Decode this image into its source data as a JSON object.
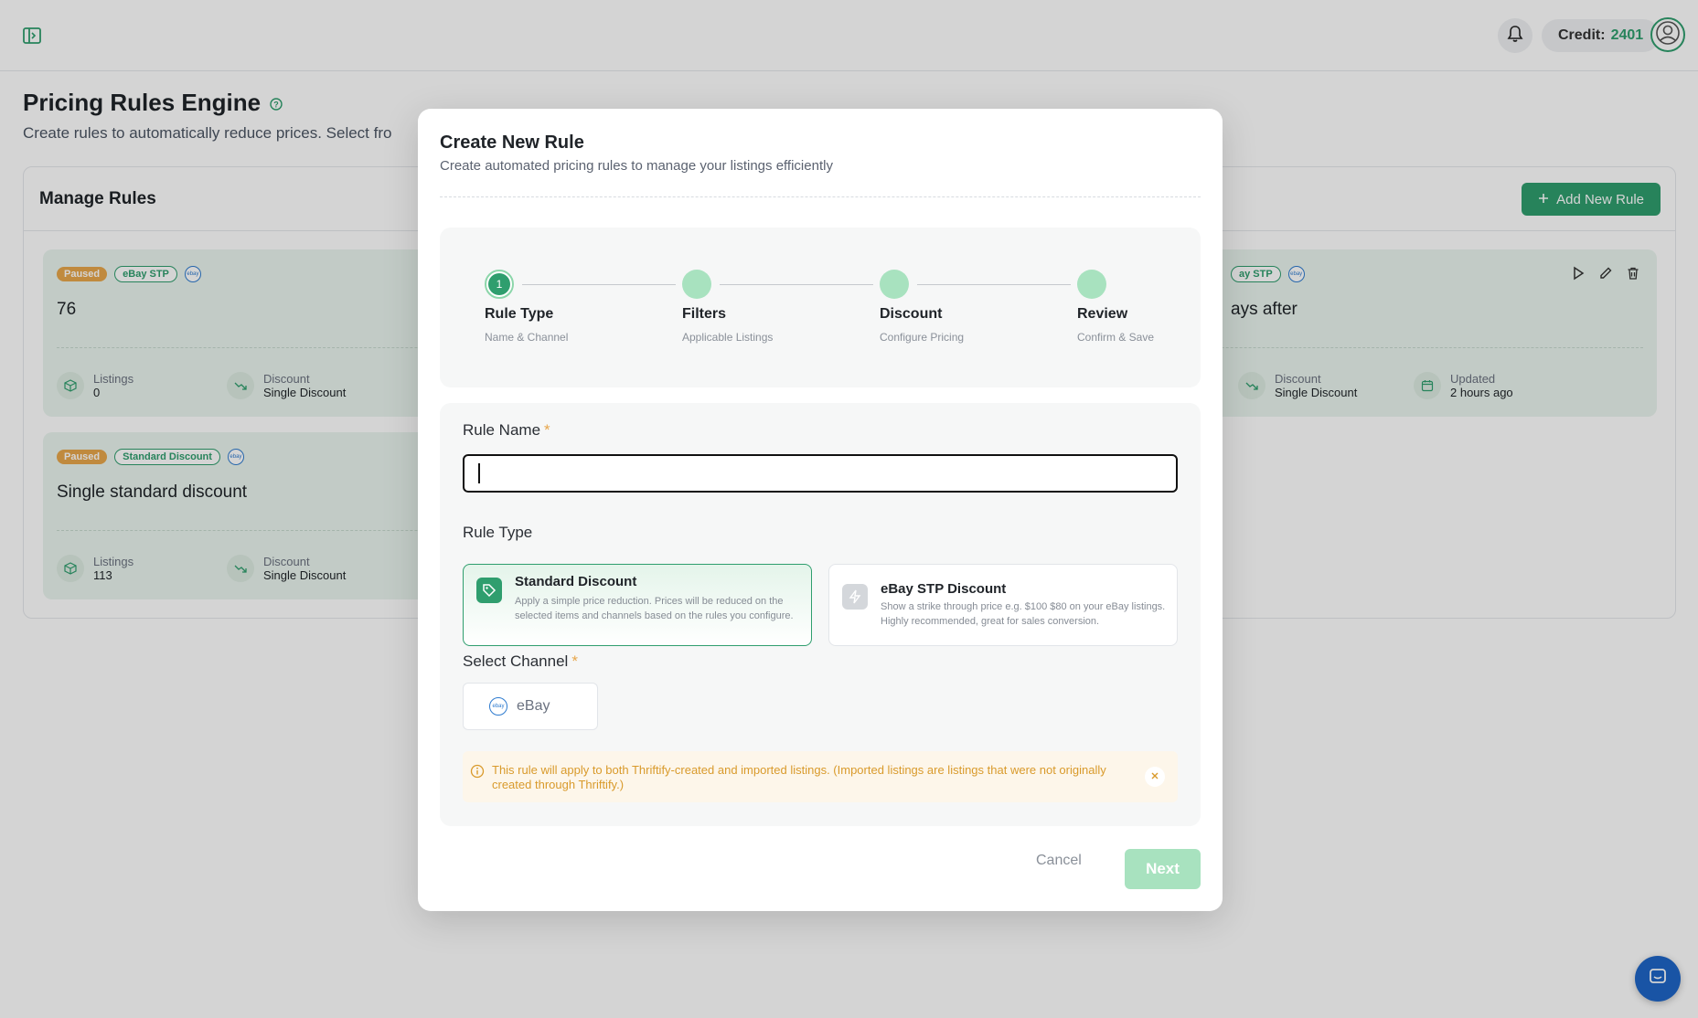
{
  "header": {
    "credit_label": "Credit:",
    "credit_value": "2401"
  },
  "page": {
    "title": "Pricing Rules Engine",
    "subtitle": "Create rules to automatically reduce prices. Select fro"
  },
  "rules": {
    "title": "Manage Rules",
    "add_button": "Add New Rule",
    "cards": [
      {
        "status": "Paused",
        "type": "eBay STP",
        "title": "76",
        "listings_label": "Listings",
        "listings": "0",
        "discount_label": "Discount",
        "discount": "Single Discount"
      },
      {
        "status": "Paused",
        "type": "Standard Discount",
        "title": "Single standard discount",
        "listings_label": "Listings",
        "listings": "113",
        "discount_label": "Discount",
        "discount": "Single Discount"
      },
      {
        "type": "ay STP",
        "title": "ays after",
        "discount_label": "Discount",
        "discount": "Single Discount",
        "updated_label": "Updated",
        "updated": "2 hours ago"
      }
    ]
  },
  "modal": {
    "title": "Create New Rule",
    "subtitle": "Create automated pricing rules to manage your listings efficiently",
    "steps": [
      {
        "number": "1",
        "label": "Rule Type",
        "desc": "Name & Channel"
      },
      {
        "label": "Filters",
        "desc": "Applicable Listings"
      },
      {
        "label": "Discount",
        "desc": "Configure Pricing"
      },
      {
        "label": "Review",
        "desc": "Confirm & Save"
      }
    ],
    "rule_name_label": "Rule Name",
    "rule_name_value": "",
    "required_mark": "*",
    "rule_type_label": "Rule Type",
    "rule_types": [
      {
        "title": "Standard Discount",
        "desc": "Apply a simple price reduction. Prices will be reduced on the selected items and channels based on the rules you configure."
      },
      {
        "title": "eBay STP Discount",
        "desc": "Show a strike through price e.g. $100 $80 on your eBay listings. Highly recommended, great for sales conversion."
      }
    ],
    "channel_label": "Select Channel",
    "channel_option": "eBay",
    "ebay_logo_text": "ebay",
    "info_text": "This rule will apply to both Thriftify-created and imported listings. (Imported listings are listings that were not originally created through Thriftify.)",
    "cancel": "Cancel",
    "next": "Next"
  },
  "colors": {
    "accent": "#2f9e6e",
    "accent_light": "#a8e2bf",
    "warning": "#e7a64b",
    "modal_bg": "#ffffff"
  }
}
